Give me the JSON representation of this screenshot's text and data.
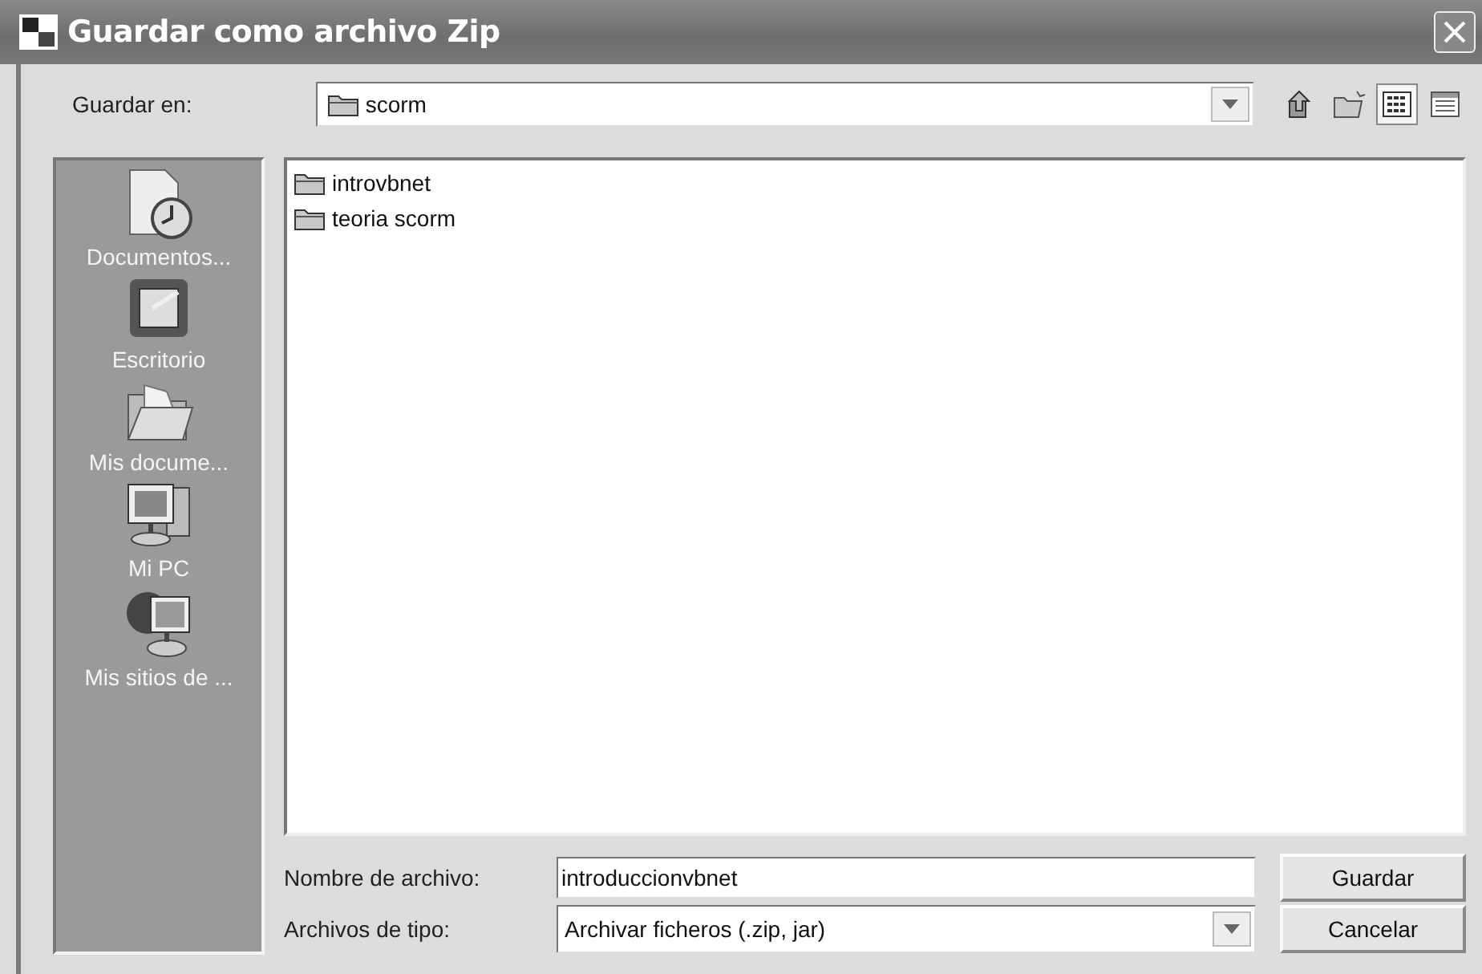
{
  "window": {
    "title": "Guardar como archivo Zip"
  },
  "look_in": {
    "label": "Guardar en:",
    "value": "scorm"
  },
  "toolbar": [
    {
      "kind": "up",
      "selected": false
    },
    {
      "kind": "newfolder",
      "selected": false
    },
    {
      "kind": "list",
      "selected": true
    },
    {
      "kind": "details",
      "selected": false
    }
  ],
  "places": [
    {
      "kind": "recent",
      "label": "Documentos..."
    },
    {
      "kind": "desktop",
      "label": "Escritorio"
    },
    {
      "kind": "documents",
      "label": "Mis docume..."
    },
    {
      "kind": "computer",
      "label": "Mi PC"
    },
    {
      "kind": "network",
      "label": "Mis sitios de ..."
    }
  ],
  "files": [
    {
      "name": "introvbnet"
    },
    {
      "name": "teoria scorm"
    }
  ],
  "file_name": {
    "label": "Nombre de archivo:",
    "value": "introduccionvbnet"
  },
  "file_type": {
    "label": "Archivos de tipo:",
    "value": "Archivar ficheros (.zip, jar)"
  },
  "buttons": [
    "Guardar",
    "Cancelar"
  ]
}
